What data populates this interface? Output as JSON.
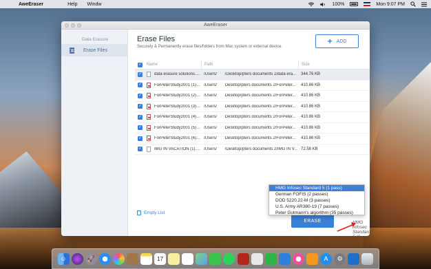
{
  "menubar": {
    "apple_glyph": "",
    "app_name": "AweEraser",
    "items": [
      "Help",
      "Windw"
    ],
    "battery": "100%",
    "clock": "Mon 9:07 PM"
  },
  "window": {
    "title": "AweEraser"
  },
  "sidebar": {
    "section": "Data Erasure",
    "items": [
      {
        "label": "Erase Files",
        "icon": "file-icon"
      }
    ]
  },
  "main": {
    "title": "Erase Files",
    "subtitle": "Securely & Permanently erase files/folders from Mac system or external device.",
    "add_label": "ADD",
    "columns": {
      "name": "Name",
      "path": "Path",
      "size": "Size"
    },
    "rows": [
      {
        "name": "data erasure solutions.docx",
        "path": "/Users/       /Desktop/pters documents 2/data era...",
        "size": "344.76 KB",
        "type": "doc",
        "selected": true
      },
      {
        "name": "ForPeterStudy2001 (1).pdf",
        "path": "/Users/       Desktop/pters documents 2/ForPeter...",
        "size": "410.86 KB",
        "type": "pdf"
      },
      {
        "name": "ForPeterStudy2001 (2).pdf",
        "path": "/Users/       Desktop/pters documents 2/ForPeter...",
        "size": "410.86 KB",
        "type": "pdf"
      },
      {
        "name": "ForPeterStudy2001 (3).pdf",
        "path": "/Users/       Desktop/pters documents 2/ForPeter...",
        "size": "410.86 KB",
        "type": "pdf"
      },
      {
        "name": "ForPeterStudy2001 (4).pdf",
        "path": "/Users/       Desktop/pters documents 2/ForPeter...",
        "size": "410.86 KB",
        "type": "pdf"
      },
      {
        "name": "ForPeterStudy2001 (5).pdf",
        "path": "/Users/       Desktop/pters documents 2/ForPeter...",
        "size": "410.86 KB",
        "type": "pdf"
      },
      {
        "name": "ForPeterStudy2001 (6).pdf",
        "path": "/Users/       Desktop/pters documents 2/ForPeter...",
        "size": "410.86 KB",
        "type": "pdf"
      },
      {
        "name": "IMG IN VACATION (1).jpg",
        "path": "/Users/       /Desktop/pters documents 2/IMG IN V...",
        "size": "72.58 KB",
        "type": "img"
      }
    ],
    "empty_list_label": "Empty List",
    "erase_label": "ERASE",
    "method_selected": "HMG Infosec Standard 5 (1 pass)",
    "method_options": [
      "HMG Infosec Standard 5 (1 pass)",
      "German FOFIS (2 passes)",
      "DOD 5220.22-M (3 passes)",
      "U.S. Army AR380-19 (7 passes)",
      "Peter Gutmann's algorithm (35 passes)"
    ]
  },
  "dock": {
    "icons": [
      "finder-icon",
      "siri-icon",
      "launchpad-icon",
      "safari-icon",
      "photos-icon",
      "contacts-icon",
      "notes-icon",
      "calendar-icon",
      "stickies-icon",
      "reminders-icon",
      "maps-icon",
      "facetime-icon",
      "messages-icon",
      "photo-booth-icon",
      "music-icon",
      "numbers-icon",
      "keynote-icon",
      "itunes-icon",
      "books-icon",
      "app-store-icon",
      "system-preferences-icon",
      "aweeraser-icon",
      "trash-icon"
    ],
    "calendar_day": "17"
  }
}
